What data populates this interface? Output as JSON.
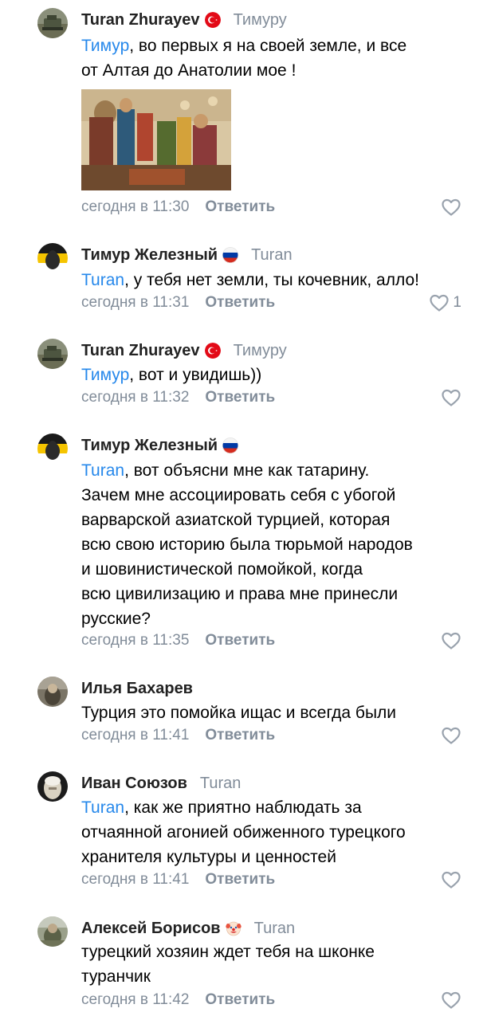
{
  "comments": [
    {
      "author": "Turan Zhurayev",
      "flag": "turkey-flag",
      "reply_to": "Тимуру",
      "mention": "Тимур",
      "text_line1": ", во первых я на своей земле, и все",
      "text_line2": "от Алтая до Анатолии мое !",
      "time": "сегодня в 11:30",
      "reply_label": "Ответить",
      "likes": ""
    },
    {
      "author": "Тимур Железный",
      "flag": "russia-flag",
      "reply_to": "Turan",
      "mention": "Turan",
      "text_line1": ", у тебя нет земли, ты кочевник, алло!",
      "time": "сегодня в 11:31",
      "reply_label": "Ответить",
      "likes": "1"
    },
    {
      "author": "Turan Zhurayev",
      "flag": "turkey-flag",
      "reply_to": "Тимуру",
      "mention": "Тимур",
      "text_line1": ", вот и увидишь))",
      "time": "сегодня в 11:32",
      "reply_label": "Ответить",
      "likes": ""
    },
    {
      "author": "Тимур Железный",
      "flag": "russia-flag",
      "reply_to": "",
      "mention": "Turan",
      "text_line1": ", вот объясни мне как татарину.",
      "text_line2": "Зачем мне ассоциировать себя с убогой",
      "text_line3": "варварской азиатской турцией, которая",
      "text_line4": "всю свою историю была тюрьмой народов",
      "text_line5": "и шовинистической помойкой, когда",
      "text_line6": "всю цивилизацию и права мне принесли",
      "text_line7": "русские?",
      "time": "сегодня в 11:35",
      "reply_label": "Ответить",
      "likes": ""
    },
    {
      "author": "Илья Бахарев",
      "text_line1": "Турция это помойка ищас  и всегда были",
      "time": "сегодня в 11:41",
      "reply_label": "Ответить",
      "likes": ""
    },
    {
      "author": "Иван Союзов",
      "reply_to": "Turan",
      "mention": "Turan",
      "text_line1": ", как же приятно наблюдать за",
      "text_line2": "отчаянной агонией обиженного турецкого",
      "text_line3": "хранителя культуры и ценностей",
      "time": "сегодня в 11:41",
      "reply_label": "Ответить",
      "likes": ""
    },
    {
      "author": "Алексей Борисов",
      "flag": "clown-emoji",
      "reply_to": "Turan",
      "text_line1": "турецкий хозяин ждет тебя на шконке",
      "text_line2": "туранчик",
      "time": "сегодня в 11:42",
      "reply_label": "Ответить",
      "likes": ""
    }
  ],
  "colors": {
    "link": "#2688eb",
    "secondary": "#818c99",
    "text": "#000000"
  }
}
